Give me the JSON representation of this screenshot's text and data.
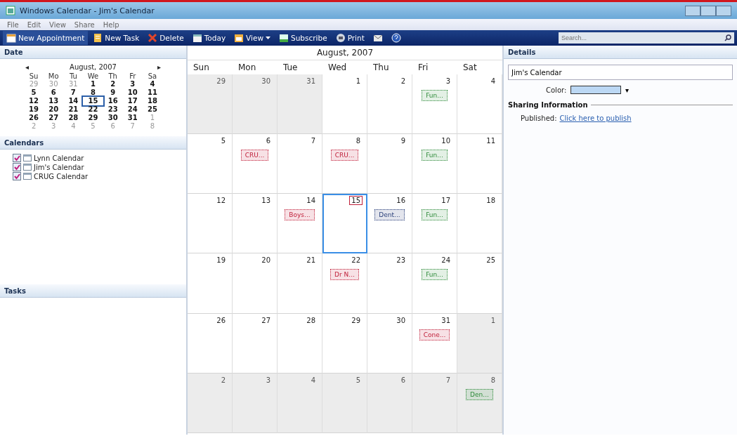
{
  "window": {
    "title": "Windows Calendar - Jim's Calendar"
  },
  "menu": [
    "File",
    "Edit",
    "View",
    "Share",
    "Help"
  ],
  "toolbar": [
    {
      "label": "New Appointment",
      "kind": "appointment"
    },
    {
      "label": "New Task",
      "kind": "task"
    },
    {
      "label": "Delete",
      "kind": "delete"
    },
    {
      "label": "Today",
      "kind": "today"
    },
    {
      "label": "View",
      "kind": "view"
    },
    {
      "label": "Subscribe",
      "kind": "subscribe"
    },
    {
      "label": "Print",
      "kind": "print"
    },
    {
      "kind": "mail"
    },
    {
      "kind": "help"
    }
  ],
  "search": {
    "placeholder": "Search..."
  },
  "date_panel": {
    "title": "Date",
    "month": "August, 2007",
    "prev": "◂",
    "next": "▸",
    "weekdays": [
      "Su",
      "Mo",
      "Tu",
      "We",
      "Th",
      "Fr",
      "Sa"
    ],
    "days": [
      {
        "d": "29",
        "other": true,
        "selected": false
      },
      {
        "d": "30",
        "other": true,
        "selected": false
      },
      {
        "d": "31",
        "other": true,
        "selected": false
      },
      {
        "d": "1",
        "other": false,
        "selected": false
      },
      {
        "d": "2",
        "other": false,
        "selected": false
      },
      {
        "d": "3",
        "other": false,
        "selected": false
      },
      {
        "d": "4",
        "other": false,
        "selected": false
      },
      {
        "d": "5",
        "other": false,
        "selected": false
      },
      {
        "d": "6",
        "other": false,
        "selected": false
      },
      {
        "d": "7",
        "other": false,
        "selected": false
      },
      {
        "d": "8",
        "other": false,
        "selected": false
      },
      {
        "d": "9",
        "other": false,
        "selected": false
      },
      {
        "d": "10",
        "other": false,
        "selected": false
      },
      {
        "d": "11",
        "other": false,
        "selected": false
      },
      {
        "d": "12",
        "other": false,
        "selected": false
      },
      {
        "d": "13",
        "other": false,
        "selected": false
      },
      {
        "d": "14",
        "other": false,
        "selected": false
      },
      {
        "d": "15",
        "other": false,
        "selected": true
      },
      {
        "d": "16",
        "other": false,
        "selected": false
      },
      {
        "d": "17",
        "other": false,
        "selected": false
      },
      {
        "d": "18",
        "other": false,
        "selected": false
      },
      {
        "d": "19",
        "other": false,
        "selected": false
      },
      {
        "d": "20",
        "other": false,
        "selected": false
      },
      {
        "d": "21",
        "other": false,
        "selected": false
      },
      {
        "d": "22",
        "other": false,
        "selected": false
      },
      {
        "d": "23",
        "other": false,
        "selected": false
      },
      {
        "d": "24",
        "other": false,
        "selected": false
      },
      {
        "d": "25",
        "other": false,
        "selected": false
      },
      {
        "d": "26",
        "other": false,
        "selected": false
      },
      {
        "d": "27",
        "other": false,
        "selected": false
      },
      {
        "d": "28",
        "other": false,
        "selected": false
      },
      {
        "d": "29",
        "other": false,
        "selected": false
      },
      {
        "d": "30",
        "other": false,
        "selected": false
      },
      {
        "d": "31",
        "other": false,
        "selected": false
      },
      {
        "d": "1",
        "other": true,
        "selected": false
      },
      {
        "d": "2",
        "other": true,
        "selected": false
      },
      {
        "d": "3",
        "other": true,
        "selected": false
      },
      {
        "d": "4",
        "other": true,
        "selected": false
      },
      {
        "d": "5",
        "other": true,
        "selected": false
      },
      {
        "d": "6",
        "other": true,
        "selected": false
      },
      {
        "d": "7",
        "other": true,
        "selected": false
      },
      {
        "d": "8",
        "other": true,
        "selected": false
      }
    ]
  },
  "calendars_panel": {
    "title": "Calendars",
    "items": [
      {
        "name": "Lynn Calendar",
        "checked": true
      },
      {
        "name": "Jim's Calendar",
        "checked": true
      },
      {
        "name": "CRUG Calendar",
        "checked": true
      }
    ]
  },
  "tasks_panel": {
    "title": "Tasks"
  },
  "month_view": {
    "title": "August, 2007",
    "weekdays": [
      "Sun",
      "Mon",
      "Tue",
      "Wed",
      "Thu",
      "Fri",
      "Sat"
    ],
    "days": [
      {
        "d": "29",
        "other": true,
        "selected": false
      },
      {
        "d": "30",
        "other": true,
        "selected": false
      },
      {
        "d": "31",
        "other": true,
        "selected": false
      },
      {
        "d": "1",
        "other": false,
        "selected": false
      },
      {
        "d": "2",
        "other": false,
        "selected": false
      },
      {
        "d": "3",
        "other": false,
        "selected": false,
        "events": [
          {
            "title": "Fun...",
            "color": "#2e8b3a"
          }
        ]
      },
      {
        "d": "4",
        "other": false,
        "selected": false
      },
      {
        "d": "5",
        "other": false,
        "selected": false
      },
      {
        "d": "6",
        "other": false,
        "selected": false,
        "events": [
          {
            "title": "CRU...",
            "color": "#c0203a"
          }
        ]
      },
      {
        "d": "7",
        "other": false,
        "selected": false
      },
      {
        "d": "8",
        "other": false,
        "selected": false,
        "events": [
          {
            "title": "CRU...",
            "color": "#c0203a"
          }
        ]
      },
      {
        "d": "9",
        "other": false,
        "selected": false
      },
      {
        "d": "10",
        "other": false,
        "selected": false,
        "events": [
          {
            "title": "Fun...",
            "color": "#2e8b3a"
          }
        ]
      },
      {
        "d": "11",
        "other": false,
        "selected": false
      },
      {
        "d": "12",
        "other": false,
        "selected": false
      },
      {
        "d": "13",
        "other": false,
        "selected": false
      },
      {
        "d": "14",
        "other": false,
        "selected": false,
        "events": [
          {
            "title": "Boys...",
            "color": "#c0203a"
          }
        ]
      },
      {
        "d": "15",
        "other": false,
        "selected": true
      },
      {
        "d": "16",
        "other": false,
        "selected": false,
        "events": [
          {
            "title": "Dent...",
            "color": "#2a3f7a"
          }
        ]
      },
      {
        "d": "17",
        "other": false,
        "selected": false,
        "events": [
          {
            "title": "Fun...",
            "color": "#2e8b3a"
          }
        ]
      },
      {
        "d": "18",
        "other": false,
        "selected": false
      },
      {
        "d": "19",
        "other": false,
        "selected": false
      },
      {
        "d": "20",
        "other": false,
        "selected": false
      },
      {
        "d": "21",
        "other": false,
        "selected": false
      },
      {
        "d": "22",
        "other": false,
        "selected": false,
        "events": [
          {
            "title": "Dr N...",
            "color": "#c0203a"
          }
        ]
      },
      {
        "d": "23",
        "other": false,
        "selected": false
      },
      {
        "d": "24",
        "other": false,
        "selected": false,
        "events": [
          {
            "title": "Fun...",
            "color": "#2e8b3a"
          }
        ]
      },
      {
        "d": "25",
        "other": false,
        "selected": false
      },
      {
        "d": "26",
        "other": false,
        "selected": false
      },
      {
        "d": "27",
        "other": false,
        "selected": false
      },
      {
        "d": "28",
        "other": false,
        "selected": false
      },
      {
        "d": "29",
        "other": false,
        "selected": false
      },
      {
        "d": "30",
        "other": false,
        "selected": false
      },
      {
        "d": "31",
        "other": false,
        "selected": false,
        "events": [
          {
            "title": "Cone...",
            "color": "#c0203a"
          }
        ]
      },
      {
        "d": "1",
        "other": true,
        "selected": false
      },
      {
        "d": "2",
        "other": true,
        "selected": false
      },
      {
        "d": "3",
        "other": true,
        "selected": false
      },
      {
        "d": "4",
        "other": true,
        "selected": false
      },
      {
        "d": "5",
        "other": true,
        "selected": false
      },
      {
        "d": "6",
        "other": true,
        "selected": false
      },
      {
        "d": "7",
        "other": true,
        "selected": false
      },
      {
        "d": "8",
        "other": true,
        "selected": false,
        "events": [
          {
            "title": "Den...",
            "color": "#2e8b3a"
          }
        ]
      }
    ]
  },
  "details": {
    "title": "Details",
    "name": "Jim's Calendar",
    "color_label": "Color:",
    "color": "#bcd8f4",
    "color_caret": "▾",
    "sharing_title": "Sharing Information",
    "published_label": "Published:",
    "publish_link": "Click here to publish"
  }
}
